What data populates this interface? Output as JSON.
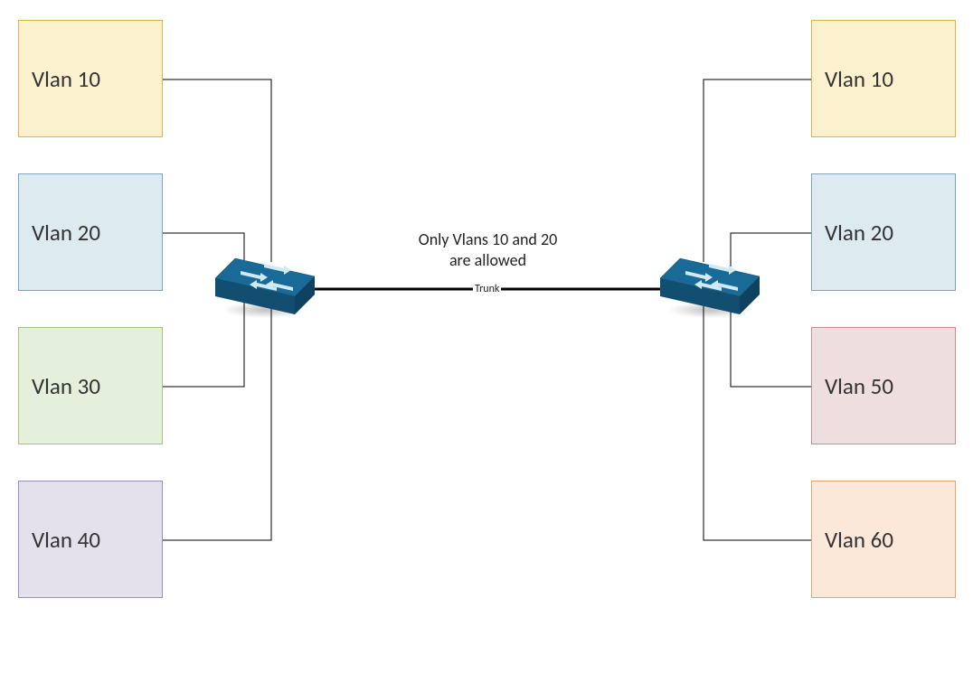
{
  "left_vlans": {
    "vlan10": {
      "label": "Vlan 10"
    },
    "vlan20": {
      "label": "Vlan 20"
    },
    "vlan30": {
      "label": "Vlan 30"
    },
    "vlan40": {
      "label": "Vlan 40"
    }
  },
  "right_vlans": {
    "vlan10": {
      "label": "Vlan 10"
    },
    "vlan20": {
      "label": "Vlan 20"
    },
    "vlan50": {
      "label": "Vlan 50"
    },
    "vlan60": {
      "label": "Vlan 60"
    }
  },
  "trunk": {
    "label": "Trunk",
    "annotation_line1": "Only Vlans 10 and 20",
    "annotation_line2": "are allowed"
  },
  "colors": {
    "switch_fill": "#1a6a97",
    "switch_stroke": "#0f4d70"
  }
}
